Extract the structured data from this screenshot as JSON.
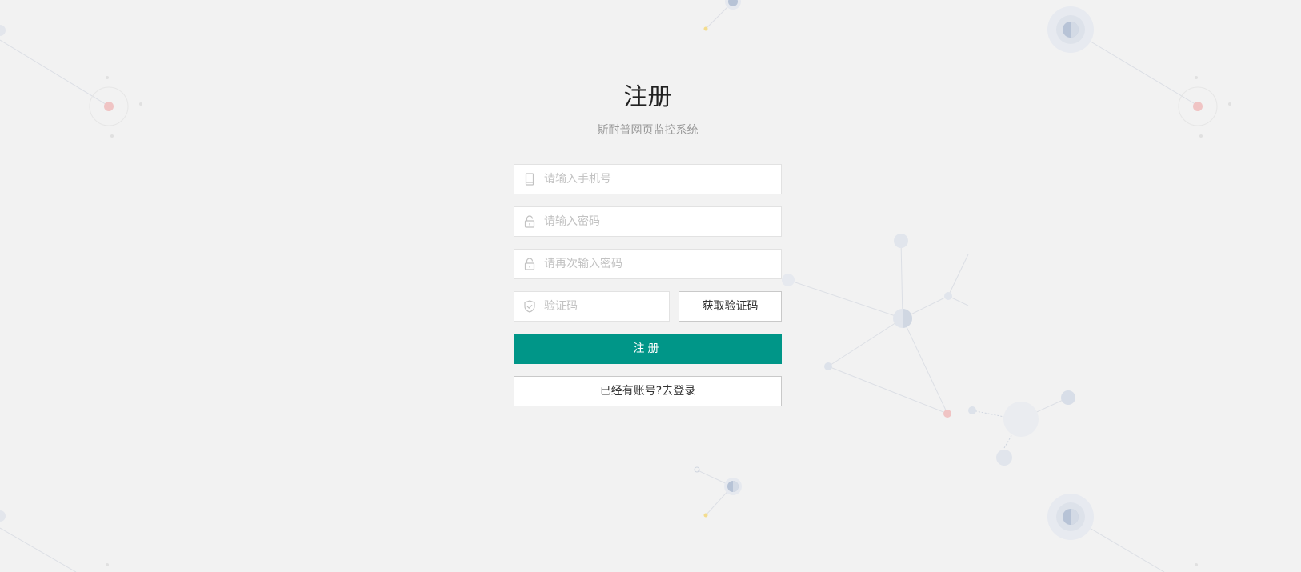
{
  "header": {
    "title": "注册",
    "subtitle": "斯耐普网页监控系统"
  },
  "form": {
    "phone": {
      "placeholder": "请输入手机号",
      "value": "",
      "icon": "phone-icon"
    },
    "password": {
      "placeholder": "请输入密码",
      "value": "",
      "icon": "lock-icon"
    },
    "confirm_password": {
      "placeholder": "请再次输入密码",
      "value": "",
      "icon": "lock-icon"
    },
    "captcha": {
      "placeholder": "验证码",
      "value": "",
      "icon": "shield-icon"
    },
    "get_code_label": "获取验证码",
    "submit_label": "注册",
    "login_link_label": "已经有账号?去登录"
  },
  "colors": {
    "background": "#f2f2f2",
    "primary": "#009688",
    "border": "#e2e2e2",
    "placeholder": "#c2c2c2",
    "decor_node": "#d5dbe6",
    "decor_node_dark": "#b7c3d6",
    "decor_red": "#f0c4c4",
    "decor_yellow": "#f3dc8e"
  }
}
